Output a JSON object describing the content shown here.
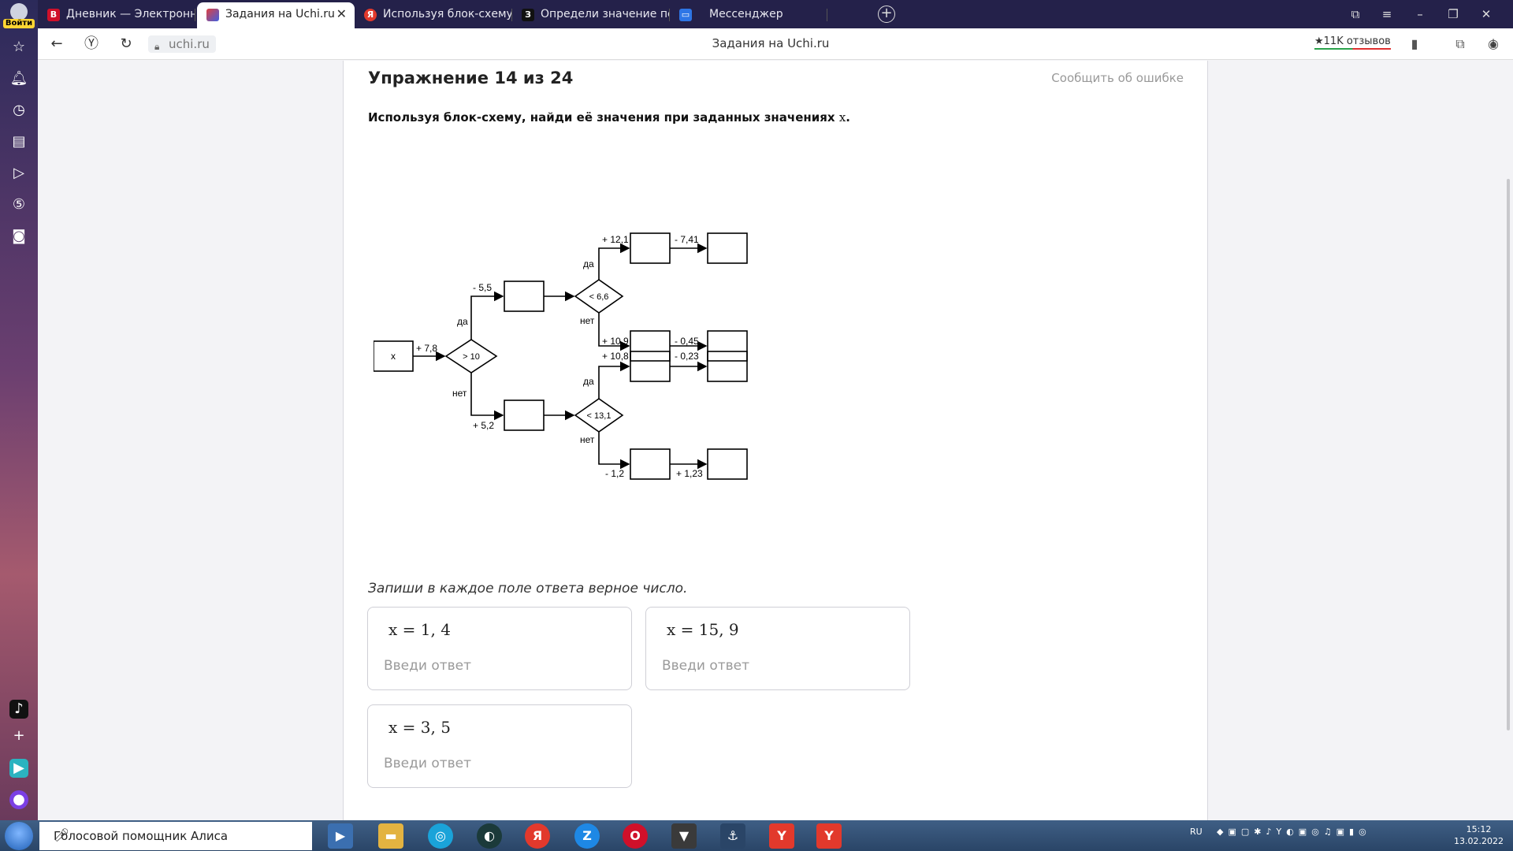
{
  "sidebar": {
    "login_label": "Войти",
    "icons": [
      "star-icon",
      "bell-icon",
      "history-icon",
      "collections-icon",
      "play-icon",
      "five-icon",
      "camera-icon",
      "tiktok-icon",
      "add-icon",
      "messenger-icon",
      "alice-icon"
    ]
  },
  "tabs": [
    {
      "label": "Дневник — Электронный",
      "fav": "В",
      "color": "#d0102a"
    },
    {
      "label": "Задания на Uchi.ru",
      "fav": "",
      "color": "#e04040"
    },
    {
      "label": "Используя блок-схему, на",
      "fav": "Я",
      "color": "#e2392c"
    },
    {
      "label": "Определи значение пере",
      "fav": "З",
      "color": "#111111"
    },
    {
      "label": "Мессенджер",
      "fav": "",
      "color": "#2e76e6"
    }
  ],
  "address": {
    "url": "uchi.ru",
    "page_title": "Задания на Uchi.ru",
    "reviews": "★11K отзывов"
  },
  "exercise": {
    "title": "Упражнение 14 из 24",
    "report": "Сообщить об ошибке",
    "task_text": "Используя блок-схему, найди её значения при заданных значениях",
    "task_var": "x",
    "instruction": "Запиши в каждое поле ответа верное число.",
    "answers": [
      {
        "question": "x = 1, 4",
        "placeholder": "Введи ответ"
      },
      {
        "question": "x = 15, 9",
        "placeholder": "Введи ответ"
      },
      {
        "question": "x = 3, 5",
        "placeholder": "Введи ответ"
      }
    ]
  },
  "diagram": {
    "start": "x",
    "add_start": "+ 7,8",
    "cond1": "> 10",
    "yes": "да",
    "no": "нет",
    "top_op": "- 5,5",
    "bottom_op": "+ 5,2",
    "cond2": "< 6,6",
    "cond3": "< 13,1",
    "ops": [
      "+ 12,1",
      "- 7,41",
      "+ 10,8",
      "- 0,23",
      "+ 10,9",
      "- 0,45",
      "- 1,2",
      "+ 1,23"
    ]
  },
  "taskbar": {
    "search": "Голосовой помощник Алиса",
    "lang": "RU",
    "time": "15:12",
    "date": "13.02.2022"
  }
}
